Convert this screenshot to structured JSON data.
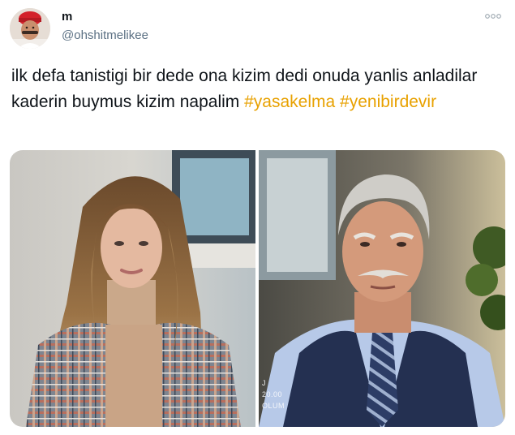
{
  "author": {
    "display_name": "m",
    "handle": "@ohshitmelikee",
    "avatar_icon": "avatar-man-in-red-cap"
  },
  "more_icon": "more-options-icon",
  "tweet": {
    "text": "ilk defa tanistigi bir dede ona kizim dedi onuda yanlis anladilar kaderin buymus kizim napalim",
    "hashtags": [
      "#yasakelma",
      "#yenibirdevir"
    ]
  },
  "media": {
    "photos": [
      {
        "description_icon": "woman-in-plaid-jacket-photo"
      },
      {
        "description_icon": "old-man-in-vest-photo",
        "overlay_line_1": "J",
        "overlay_line_2": "20.00",
        "overlay_line_3": "OLUM"
      }
    ]
  },
  "colors": {
    "hashtag": "#e8a100",
    "text": "#0f1419",
    "secondary": "#5b7083",
    "background": "#ffffff"
  }
}
